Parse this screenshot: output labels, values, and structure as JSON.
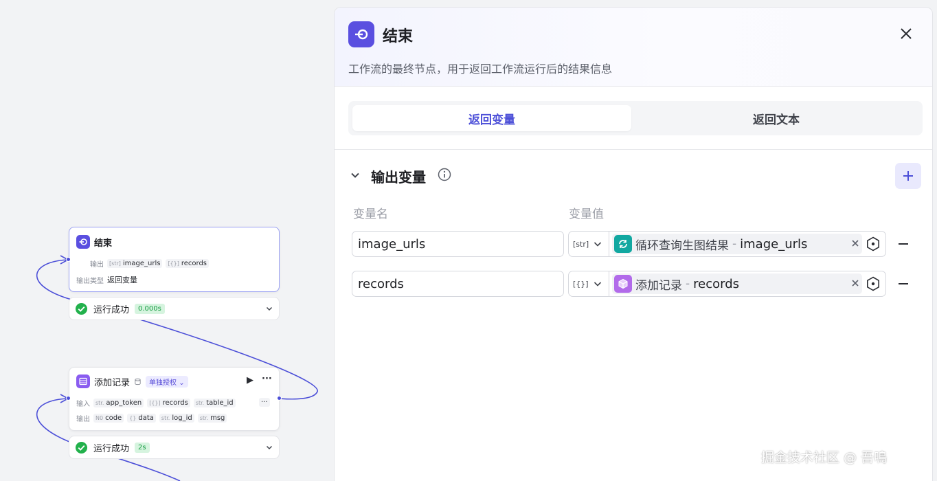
{
  "canvas": {
    "end_node": {
      "title": "结束",
      "output_label": "输出",
      "outputs": [
        {
          "type": "[str]",
          "name": "image_urls"
        },
        {
          "type": "[{}]",
          "name": "records"
        }
      ],
      "output_type_label": "输出类型",
      "output_type_value": "返回变量",
      "status": {
        "text": "运行成功",
        "time": "0.000s"
      }
    },
    "record_node": {
      "title": "添加记录",
      "auth_tag": "单独授权",
      "input_label": "输入",
      "inputs": [
        {
          "type": "str.",
          "name": "app_token"
        },
        {
          "type": "[{}]",
          "name": "records"
        },
        {
          "type": "str.",
          "name": "table_id"
        }
      ],
      "output_label": "输出",
      "outputs": [
        {
          "type": "N0",
          "name": "code"
        },
        {
          "type": "{}",
          "name": "data"
        },
        {
          "type": "str.",
          "name": "log_id"
        },
        {
          "type": "str.",
          "name": "msg"
        }
      ],
      "status": {
        "text": "运行成功",
        "time": "2s"
      }
    }
  },
  "panel": {
    "title": "结束",
    "description": "工作流的最终节点，用于返回工作流运行后的结果信息",
    "tabs": [
      {
        "label": "返回变量",
        "active": true
      },
      {
        "label": "返回文本",
        "active": false
      }
    ],
    "section": {
      "title": "输出变量",
      "col_name": "变量名",
      "col_value": "变量值",
      "rows": [
        {
          "name": "image_urls",
          "type": "[str]",
          "ref_node": "循环查询生图结果",
          "ref_sep": "-",
          "ref_var": "image_urls",
          "ref_color": "#12a8a1"
        },
        {
          "name": "records",
          "type": "[{}]",
          "ref_node": "添加记录",
          "ref_sep": "-",
          "ref_var": "records",
          "ref_color": "#b26bea"
        }
      ]
    }
  },
  "colors": {
    "accent": "#4c4fd8",
    "success": "#149b3f",
    "end_icon": "#5a4fe0"
  },
  "watermark": "掘金技术社区 @ 吾鳴"
}
